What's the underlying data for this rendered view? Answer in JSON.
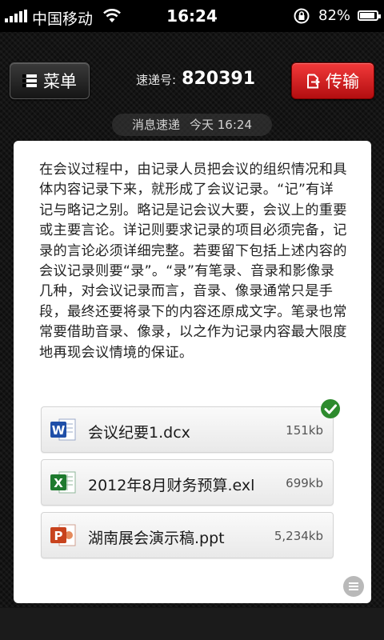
{
  "status_bar": {
    "carrier": "中国移动",
    "time": "16:24",
    "battery_text": "82%",
    "battery_level": 0.82,
    "icons": [
      "signal-icon",
      "wifi-icon",
      "rotation-lock-icon",
      "battery-icon"
    ]
  },
  "nav": {
    "menu_label": "菜单",
    "code_label": "速递号:",
    "code_value": "820391",
    "send_label": "传输"
  },
  "message": {
    "sender": "消息速递",
    "time": "今天 16:24",
    "body": "在会议过程中，由记录人员把会议的组织情况和具体内容记录下来，就形成了会议记录。“记”有详记与略记之别。略记是记会议大要，会议上的重要或主要言论。详记则要求记录的项目必须完备，记录的言论必须详细完整。若要留下包括上述内容的会议记录则要“录”。“录”有笔录、音录和影像录几种，对会议记录而言，音录、像录通常只是手段，最终还要将录下的内容还原成文字。笔录也常常要借助音录、像录，以之作为记录内容最大限度地再现会议情境的保证。"
  },
  "attachments": [
    {
      "name": "会议纪要1.dcx",
      "size": "151kb",
      "icon": "word-document-icon",
      "icon_letter": "W",
      "color": "#1f4fa8",
      "checked": true
    },
    {
      "name": "2012年8月财务预算.exl",
      "size": "699kb",
      "icon": "excel-document-icon",
      "icon_letter": "X",
      "color": "#1e7a2e",
      "checked": false
    },
    {
      "name": "湖南展会演示稿.ppt",
      "size": "5,234kb",
      "icon": "powerpoint-document-icon",
      "icon_letter": "P",
      "color": "#c8431d",
      "checked": false
    }
  ],
  "colors": {
    "send_button": "#d81e1e",
    "check_badge": "#2e8b2e",
    "card_background": "#ffffff"
  }
}
